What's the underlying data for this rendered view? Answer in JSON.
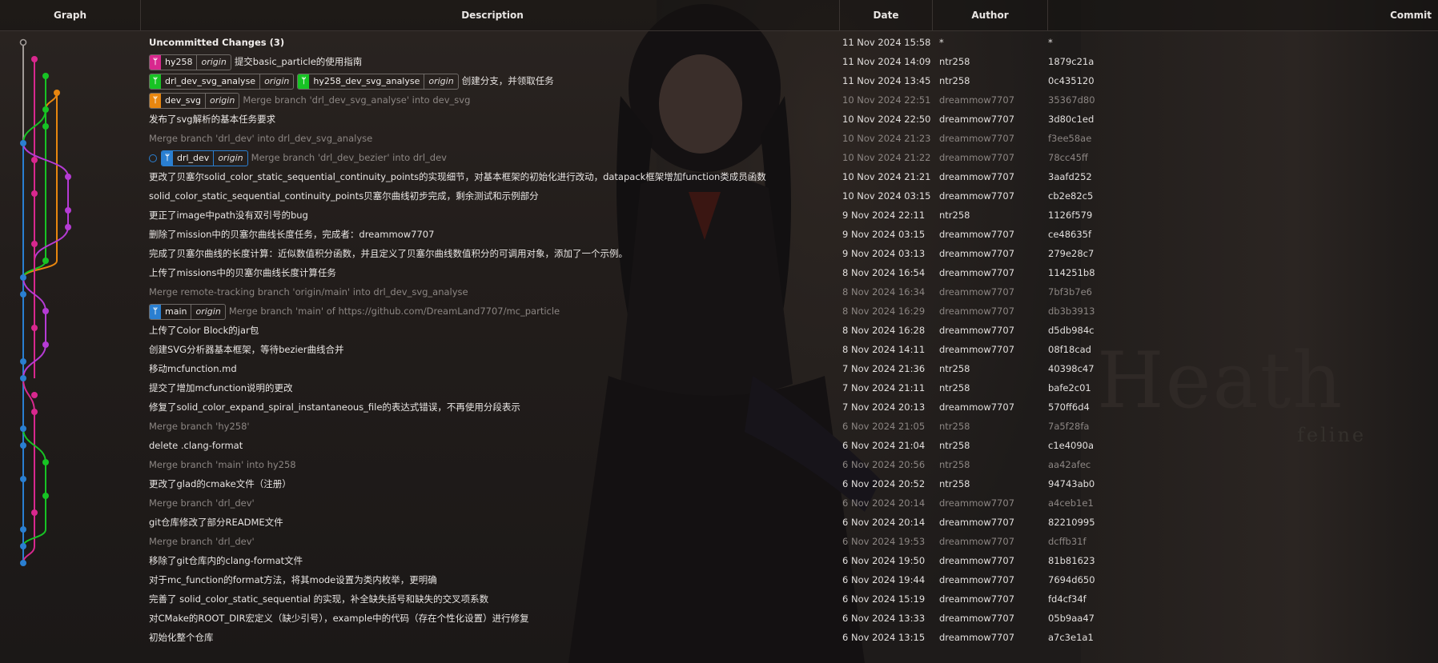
{
  "columns": {
    "graph": "Graph",
    "description": "Description",
    "date": "Date",
    "author": "Author",
    "commit": "Commit"
  },
  "background": {
    "watermark": "Heath",
    "watermark_sub": "feline"
  },
  "colors": {
    "pink": "#d8288e",
    "green": "#17c324",
    "orange": "#e8860f",
    "blue": "#2a7fd1",
    "purple": "#b53bd4",
    "grey": "#a09a96"
  },
  "commits": [
    {
      "refs": [],
      "message": "Uncommitted Changes (3)",
      "date": "11 Nov 2024 15:58",
      "author": "*",
      "hash": "*",
      "bold": true
    },
    {
      "refs": [
        {
          "name": "hy258",
          "origin": "origin",
          "icon_color": "#d8288e"
        }
      ],
      "message": "提交basic_particle的使用指南",
      "date": "11 Nov 2024 14:09",
      "author": "ntr258",
      "hash": "1879c21a"
    },
    {
      "refs": [
        {
          "name": "drl_dev_svg_analyse",
          "origin": "origin",
          "icon_color": "#17c324"
        },
        {
          "name": "hy258_dev_svg_analyse",
          "origin": "origin",
          "icon_color": "#17c324"
        }
      ],
      "message": "创建分支，并领取任务",
      "date": "11 Nov 2024 13:45",
      "author": "ntr258",
      "hash": "0c435120"
    },
    {
      "refs": [
        {
          "name": "dev_svg",
          "origin": "origin",
          "icon_color": "#e8860f"
        }
      ],
      "message": "Merge branch 'drl_dev_svg_analyse' into dev_svg",
      "date": "10 Nov 2024 22:51",
      "author": "dreammow7707",
      "hash": "35367d80",
      "merge": true
    },
    {
      "refs": [],
      "message": "发布了svg解析的基本任务要求",
      "date": "10 Nov 2024 22:50",
      "author": "dreammow7707",
      "hash": "3d80c1ed"
    },
    {
      "refs": [],
      "message": "Merge branch 'drl_dev' into drl_dev_svg_analyse",
      "date": "10 Nov 2024 21:23",
      "author": "dreammow7707",
      "hash": "f3ee58ae",
      "merge": true
    },
    {
      "refs": [
        {
          "name": "drl_dev",
          "origin": "origin",
          "icon_color": "#2a7fd1",
          "head": true
        }
      ],
      "message": "Merge branch 'drl_dev_bezier' into drl_dev",
      "date": "10 Nov 2024 21:22",
      "author": "dreammow7707",
      "hash": "78cc45ff",
      "merge": true
    },
    {
      "refs": [],
      "message": "更改了贝塞尔solid_color_static_sequential_continuity_points的实现细节，对基本框架的初始化进行改动，datapack框架增加function类成员函数",
      "date": "10 Nov 2024 21:21",
      "author": "dreammow7707",
      "hash": "3aafd252"
    },
    {
      "refs": [],
      "message": "solid_color_static_sequential_continuity_points贝塞尔曲线初步完成，剩余测试和示例部分",
      "date": "10 Nov 2024 03:15",
      "author": "dreammow7707",
      "hash": "cb2e82c5"
    },
    {
      "refs": [],
      "message": "更正了image中path没有双引号的bug",
      "date": "9 Nov 2024 22:11",
      "author": "ntr258",
      "hash": "1126f579"
    },
    {
      "refs": [],
      "message": "删除了mission中的贝塞尔曲线长度任务，完成者：dreammow7707",
      "date": "9 Nov 2024 03:15",
      "author": "dreammow7707",
      "hash": "ce48635f"
    },
    {
      "refs": [],
      "message": "完成了贝塞尔曲线的长度计算：近似数值积分函数，并且定义了贝塞尔曲线数值积分的可调用对象，添加了一个示例。",
      "date": "9 Nov 2024 03:13",
      "author": "dreammow7707",
      "hash": "279e28c7"
    },
    {
      "refs": [],
      "message": "上传了missions中的贝塞尔曲线长度计算任务",
      "date": "8 Nov 2024 16:54",
      "author": "dreammow7707",
      "hash": "114251b8"
    },
    {
      "refs": [],
      "message": "Merge remote-tracking branch 'origin/main' into drl_dev_svg_analyse",
      "date": "8 Nov 2024 16:34",
      "author": "dreammow7707",
      "hash": "7bf3b7e6",
      "merge": true
    },
    {
      "refs": [
        {
          "name": "main",
          "origin": "origin",
          "icon_color": "#2a7fd1"
        }
      ],
      "message": "Merge branch 'main' of https://github.com/DreamLand7707/mc_particle",
      "date": "8 Nov 2024 16:29",
      "author": "dreammow7707",
      "hash": "db3b3913",
      "merge": true
    },
    {
      "refs": [],
      "message": "上传了Color Block的jar包",
      "date": "8 Nov 2024 16:28",
      "author": "dreammow7707",
      "hash": "d5db984c"
    },
    {
      "refs": [],
      "message": "创建SVG分析器基本框架，等待bezier曲线合并",
      "date": "8 Nov 2024 14:11",
      "author": "dreammow7707",
      "hash": "08f18cad"
    },
    {
      "refs": [],
      "message": "移动mcfunction.md",
      "date": "7 Nov 2024 21:36",
      "author": "ntr258",
      "hash": "40398c47"
    },
    {
      "refs": [],
      "message": "提交了增加mcfunction说明的更改",
      "date": "7 Nov 2024 21:11",
      "author": "ntr258",
      "hash": "bafe2c01"
    },
    {
      "refs": [],
      "message": "修复了solid_color_expand_spiral_instantaneous_file的表达式错误，不再使用分段表示",
      "date": "7 Nov 2024 20:13",
      "author": "dreammow7707",
      "hash": "570ff6d4"
    },
    {
      "refs": [],
      "message": "Merge branch 'hy258'",
      "date": "6 Nov 2024 21:05",
      "author": "ntr258",
      "hash": "7a5f28fa",
      "merge": true
    },
    {
      "refs": [],
      "message": "delete .clang-format",
      "date": "6 Nov 2024 21:04",
      "author": "ntr258",
      "hash": "c1e4090a"
    },
    {
      "refs": [],
      "message": "Merge branch 'main' into hy258",
      "date": "6 Nov 2024 20:56",
      "author": "ntr258",
      "hash": "aa42afec",
      "merge": true
    },
    {
      "refs": [],
      "message": "更改了glad的cmake文件（注册）",
      "date": "6 Nov 2024 20:52",
      "author": "ntr258",
      "hash": "94743ab0"
    },
    {
      "refs": [],
      "message": "Merge branch 'drl_dev'",
      "date": "6 Nov 2024 20:14",
      "author": "dreammow7707",
      "hash": "a4ceb1e1",
      "merge": true
    },
    {
      "refs": [],
      "message": "git仓库修改了部分README文件",
      "date": "6 Nov 2024 20:14",
      "author": "dreammow7707",
      "hash": "82210995"
    },
    {
      "refs": [],
      "message": "Merge branch 'drl_dev'",
      "date": "6 Nov 2024 19:53",
      "author": "dreammow7707",
      "hash": "dcffb31f",
      "merge": true
    },
    {
      "refs": [],
      "message": "移除了git仓库内的clang-format文件",
      "date": "6 Nov 2024 19:50",
      "author": "dreammow7707",
      "hash": "81b81623"
    },
    {
      "refs": [],
      "message": "对于mc_function的format方法，将其mode设置为类内枚举，更明确",
      "date": "6 Nov 2024 19:44",
      "author": "dreammow7707",
      "hash": "7694d650"
    },
    {
      "refs": [],
      "message": "完善了 solid_color_static_sequential 的实现，补全缺失括号和缺失的交叉项系数",
      "date": "6 Nov 2024 15:19",
      "author": "dreammow7707",
      "hash": "fd4cf34f"
    },
    {
      "refs": [],
      "message": "对CMake的ROOT_DIR宏定义（缺少引号），example中的代码（存在个性化设置）进行修复",
      "date": "6 Nov 2024 13:33",
      "author": "dreammow7707",
      "hash": "05b9aa47"
    },
    {
      "refs": [],
      "message": "初始化整个仓库",
      "date": "6 Nov 2024 13:15",
      "author": "dreammow7707",
      "hash": "a7c3e1a1"
    }
  ]
}
